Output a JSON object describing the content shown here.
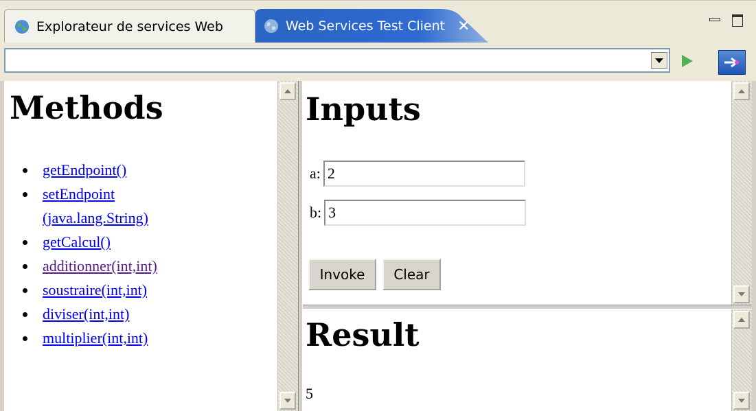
{
  "tabs": {
    "explorer_label": "Explorateur de services Web",
    "test_client_label": "Web Services Test Client"
  },
  "toolbar": {
    "url_value": ""
  },
  "methods": {
    "title": "Methods",
    "items": [
      {
        "line1": "getEndpoint()",
        "line2": ""
      },
      {
        "line1": "setEndpoint",
        "line2": "(java.lang.String)"
      },
      {
        "line1": "getCalcul()",
        "line2": ""
      },
      {
        "line1": "additionner(int,int)",
        "line2": "",
        "visited": true
      },
      {
        "line1": "soustraire(int,int)",
        "line2": ""
      },
      {
        "line1": "diviser(int,int)",
        "line2": ""
      },
      {
        "line1": "multiplier(int,int)",
        "line2": ""
      }
    ]
  },
  "inputs": {
    "title": "Inputs",
    "a_label": "a:",
    "a_value": "2",
    "b_label": "b:",
    "b_value": "3",
    "invoke_label": "Invoke",
    "clear_label": "Clear"
  },
  "result": {
    "title": "Result",
    "value": "5"
  },
  "colors": {
    "link": "#0000ee",
    "visited_link": "#551a8b",
    "active_tab": "#1d56b8"
  }
}
